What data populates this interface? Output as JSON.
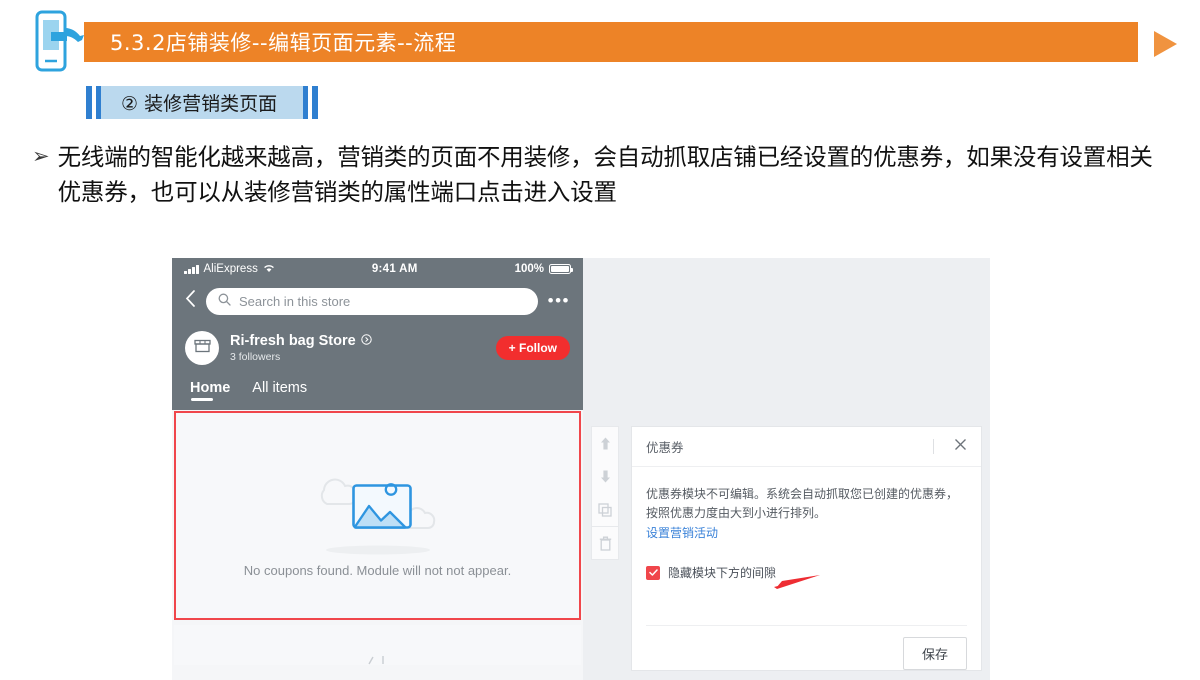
{
  "slide": {
    "header_title": "5.3.2店铺装修--编辑页面元素--流程",
    "header_color": "#ED8327",
    "subtitle": "② 装修营销类页面",
    "subtitle_bg": "#BBD9EE",
    "subtitle_bar_color": "#2F7FD0",
    "bullet_marker": "➢",
    "body_paragraph": "无线端的智能化越来越高，营销类的页面不用装修，会自动抓取店铺已经设置的优惠券，如果没有设置相关优惠券，也可以从装修营销类的属性端口点击进入设置",
    "next_arrow_icon": "play-triangle-icon",
    "phone_hand_icon": "phone-hand-pointer-icon"
  },
  "phone": {
    "status_bar": {
      "signal_icon": "signal-bars-icon",
      "carrier": "AliExpress",
      "wifi_icon": "wifi-icon",
      "time": "9:41 AM",
      "battery_percent": "100%",
      "battery_icon": "battery-full-icon"
    },
    "nav": {
      "back_icon": "chevron-left-icon",
      "search_icon": "search-icon",
      "search_placeholder": "Search in this store",
      "more_icon": "more-dots-icon"
    },
    "store": {
      "avatar_icon": "storefront-icon",
      "name": "Ri-fresh bag Store",
      "name_badge_icon": "chevron-right-circle-icon",
      "followers": "3 followers",
      "follow_button": "+ Follow",
      "follow_color": "#F22E2E"
    },
    "tabs": [
      {
        "label": "Home",
        "active": true
      },
      {
        "label": "All items",
        "active": false
      }
    ],
    "coupon_module": {
      "selected_border_color": "#F0464B",
      "placeholder_icon": "image-placeholder-icon",
      "empty_text": "No coupons found. Module will not not appear."
    }
  },
  "editor": {
    "toolbar": [
      {
        "icon": "arrow-up-icon",
        "label": "上移"
      },
      {
        "icon": "arrow-down-icon",
        "label": "下移"
      },
      {
        "icon": "copy-icon",
        "label": "复制"
      },
      {
        "icon": "trash-icon",
        "label": "删除"
      }
    ],
    "panel": {
      "title": "优惠券",
      "close_icon": "close-icon",
      "description": "优惠券模块不可编辑。系统会自动抓取您已创建的优惠券，按照优惠力度由大到小进行排列。",
      "link_text": "设置营销活动",
      "link_color": "#3A82D8",
      "annotation_arrow_icon": "red-arrow-icon",
      "checkbox": {
        "checked": true,
        "label": "隐藏模块下方的间隙",
        "color": "#F0464B"
      },
      "save_button": "保存"
    }
  }
}
